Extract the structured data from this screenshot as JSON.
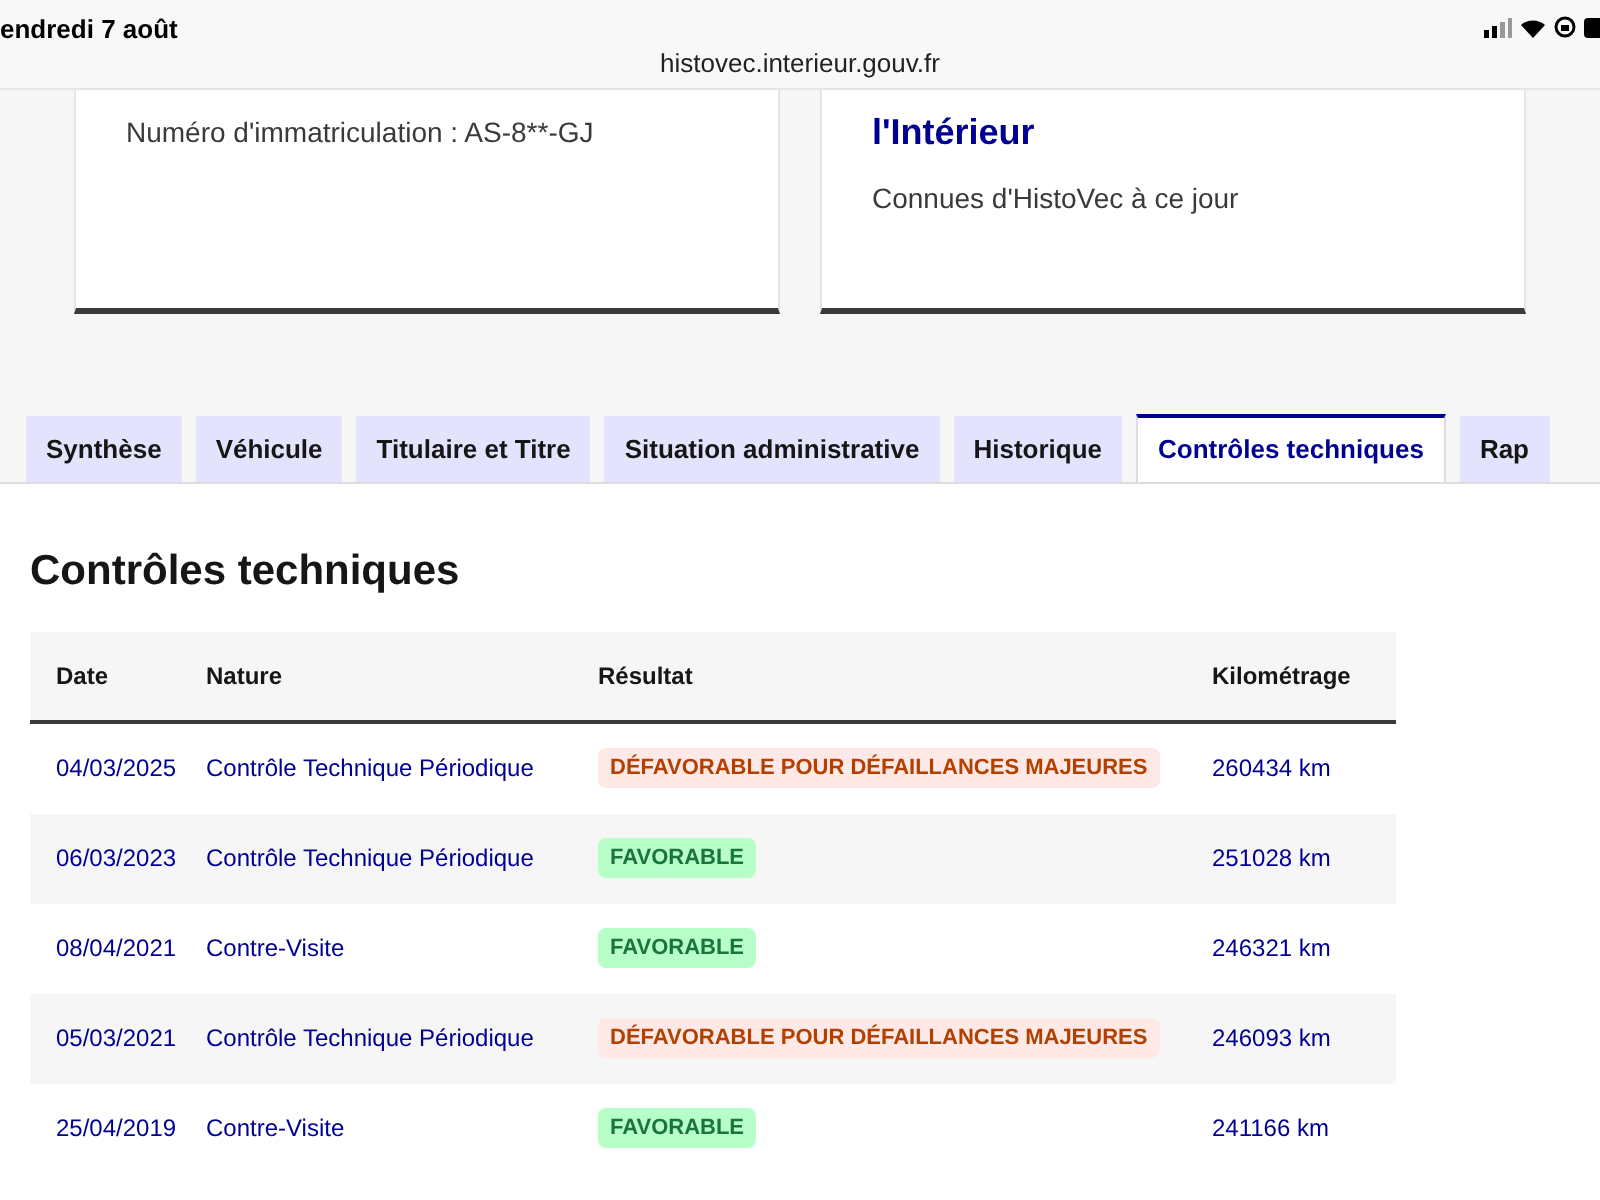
{
  "status_bar": {
    "date": "endredi 7 août",
    "url": "histovec.interieur.gouv.fr"
  },
  "cards": [
    {
      "text": "Numéro d'immatriculation : AS-8**-GJ"
    },
    {
      "title": "l'Intérieur",
      "text": "Connues d'HistoVec à ce jour"
    }
  ],
  "tabs": [
    {
      "label": "Synthèse",
      "selected": false
    },
    {
      "label": "Véhicule",
      "selected": false
    },
    {
      "label": "Titulaire et Titre",
      "selected": false
    },
    {
      "label": "Situation administrative",
      "selected": false
    },
    {
      "label": "Historique",
      "selected": false
    },
    {
      "label": "Contrôles techniques",
      "selected": true
    },
    {
      "label": "Rap",
      "selected": false
    }
  ],
  "section": {
    "title": "Contrôles techniques"
  },
  "table": {
    "columns": [
      "Date",
      "Nature",
      "Résultat",
      "Kilométrage"
    ],
    "rows": [
      {
        "date": "04/03/2025",
        "nature": "Contrôle Technique Périodique",
        "result": {
          "label": "DÉFAVORABLE POUR DÉFAILLANCES MAJEURES",
          "kind": "unfavorable"
        },
        "km": "260434 km"
      },
      {
        "date": "06/03/2023",
        "nature": "Contrôle Technique Périodique",
        "result": {
          "label": "FAVORABLE",
          "kind": "favorable"
        },
        "km": "251028 km"
      },
      {
        "date": "08/04/2021",
        "nature": "Contre-Visite",
        "result": {
          "label": "FAVORABLE",
          "kind": "favorable"
        },
        "km": "246321 km"
      },
      {
        "date": "05/03/2021",
        "nature": "Contrôle Technique Périodique",
        "result": {
          "label": "DÉFAVORABLE POUR DÉFAILLANCES MAJEURES",
          "kind": "unfavorable"
        },
        "km": "246093 km"
      },
      {
        "date": "25/04/2019",
        "nature": "Contre-Visite",
        "result": {
          "label": "FAVORABLE",
          "kind": "favorable"
        },
        "km": "241166 km"
      }
    ]
  }
}
